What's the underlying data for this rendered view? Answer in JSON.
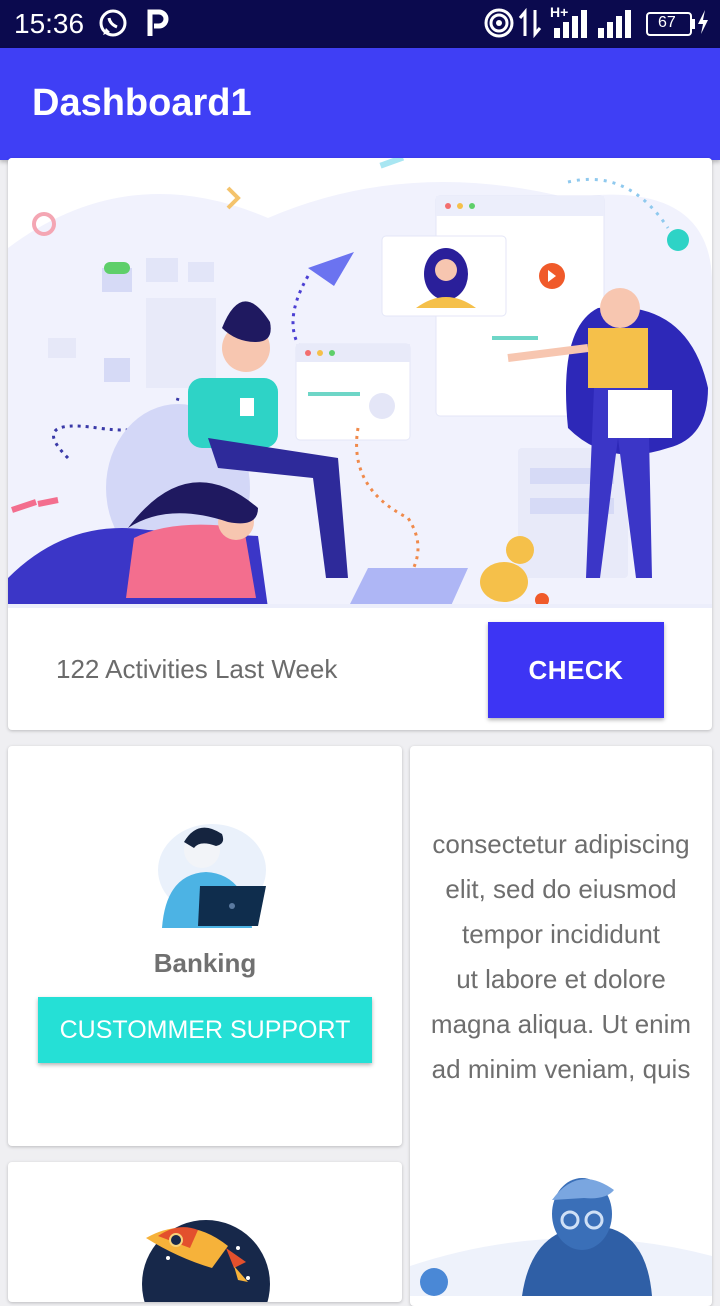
{
  "status_bar": {
    "time": "15:36",
    "battery": "67",
    "network_type": "H+",
    "icons": [
      "whatsapp-icon",
      "parking-icon",
      "hotspot-icon",
      "data-arrows-icon",
      "signal-icon",
      "signal-icon-2",
      "battery-icon",
      "charging-icon"
    ]
  },
  "app_bar": {
    "title": "Dashboard1"
  },
  "hero_card": {
    "activities_text": "122  Activities Last Week",
    "check_label": "CHECK"
  },
  "banking_card": {
    "label": "Banking",
    "button_label": "CUSTOMMER SUPPORT"
  },
  "text_card": {
    "lines": [
      "consectetur adipiscing",
      "elit, sed do eiusmod",
      "tempor incididunt",
      "ut labore et dolore",
      "magna aliqua. Ut enim",
      "ad minim veniam, quis"
    ]
  },
  "colors": {
    "status_bar": "#0b0a4e",
    "app_bar": "#3f3ff5",
    "accent_button": "#3d35f4",
    "support_button": "#25e0d6"
  }
}
